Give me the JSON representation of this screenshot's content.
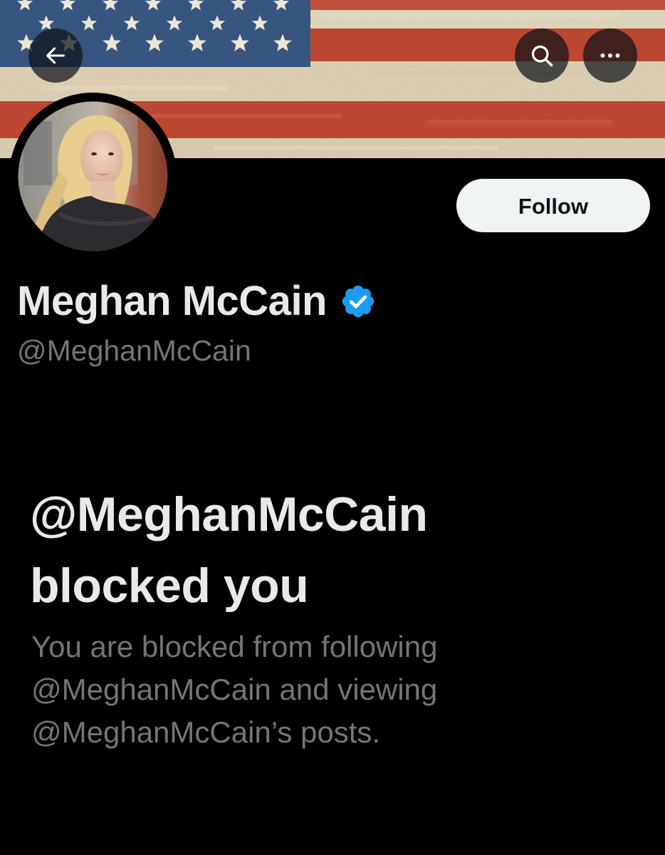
{
  "header": {
    "back_icon": "arrow-left-icon",
    "search_icon": "search-icon",
    "more_icon": "more-horizontal-icon"
  },
  "profile": {
    "display_name": "Meghan McCain",
    "verified": true,
    "verified_color": "#1d9bf0",
    "handle": "@MeghanMcCain",
    "follow_label": "Follow"
  },
  "blocked": {
    "title_line1": "@MeghanMcCain",
    "title_line2": "blocked you",
    "desc_line1": "You are blocked from following",
    "desc_line2": "@MeghanMcCain and viewing",
    "desc_line3": "@MeghanMcCain’s posts."
  },
  "colors": {
    "background": "#000000",
    "primary_text": "#e7e9ea",
    "secondary_text": "#71767b",
    "follow_button_bg": "#eff3f4",
    "follow_button_text": "#0f1419"
  }
}
